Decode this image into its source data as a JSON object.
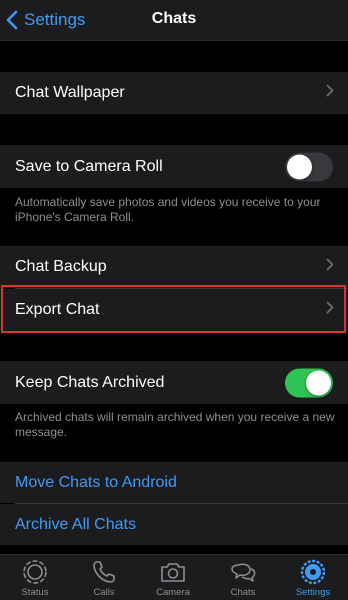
{
  "nav": {
    "back_label": "Settings",
    "title": "Chats"
  },
  "rows": {
    "chat_wallpaper": "Chat Wallpaper",
    "save_to_camera_roll": "Save to Camera Roll",
    "save_note": "Automatically save photos and videos you receive to your iPhone's Camera Roll.",
    "chat_backup": "Chat Backup",
    "export_chat": "Export Chat",
    "keep_archived": "Keep Chats Archived",
    "archived_note": "Archived chats will remain archived when you receive a new message.",
    "move_to_android": "Move Chats to Android",
    "archive_all": "Archive All Chats"
  },
  "toggles": {
    "save_to_camera_roll": false,
    "keep_chats_archived": true
  },
  "tabs": [
    {
      "label": "Status",
      "icon": "status-icon"
    },
    {
      "label": "Calls",
      "icon": "phone-icon"
    },
    {
      "label": "Camera",
      "icon": "camera-icon"
    },
    {
      "label": "Chats",
      "icon": "chat-bubbles-icon"
    },
    {
      "label": "Settings",
      "icon": "gear-icon",
      "active": true
    }
  ],
  "colors": {
    "accent": "#3f9bf5",
    "toggle_on": "#2fc455",
    "highlight_border": "#d8362c",
    "cell_bg": "#1c1c1e"
  }
}
